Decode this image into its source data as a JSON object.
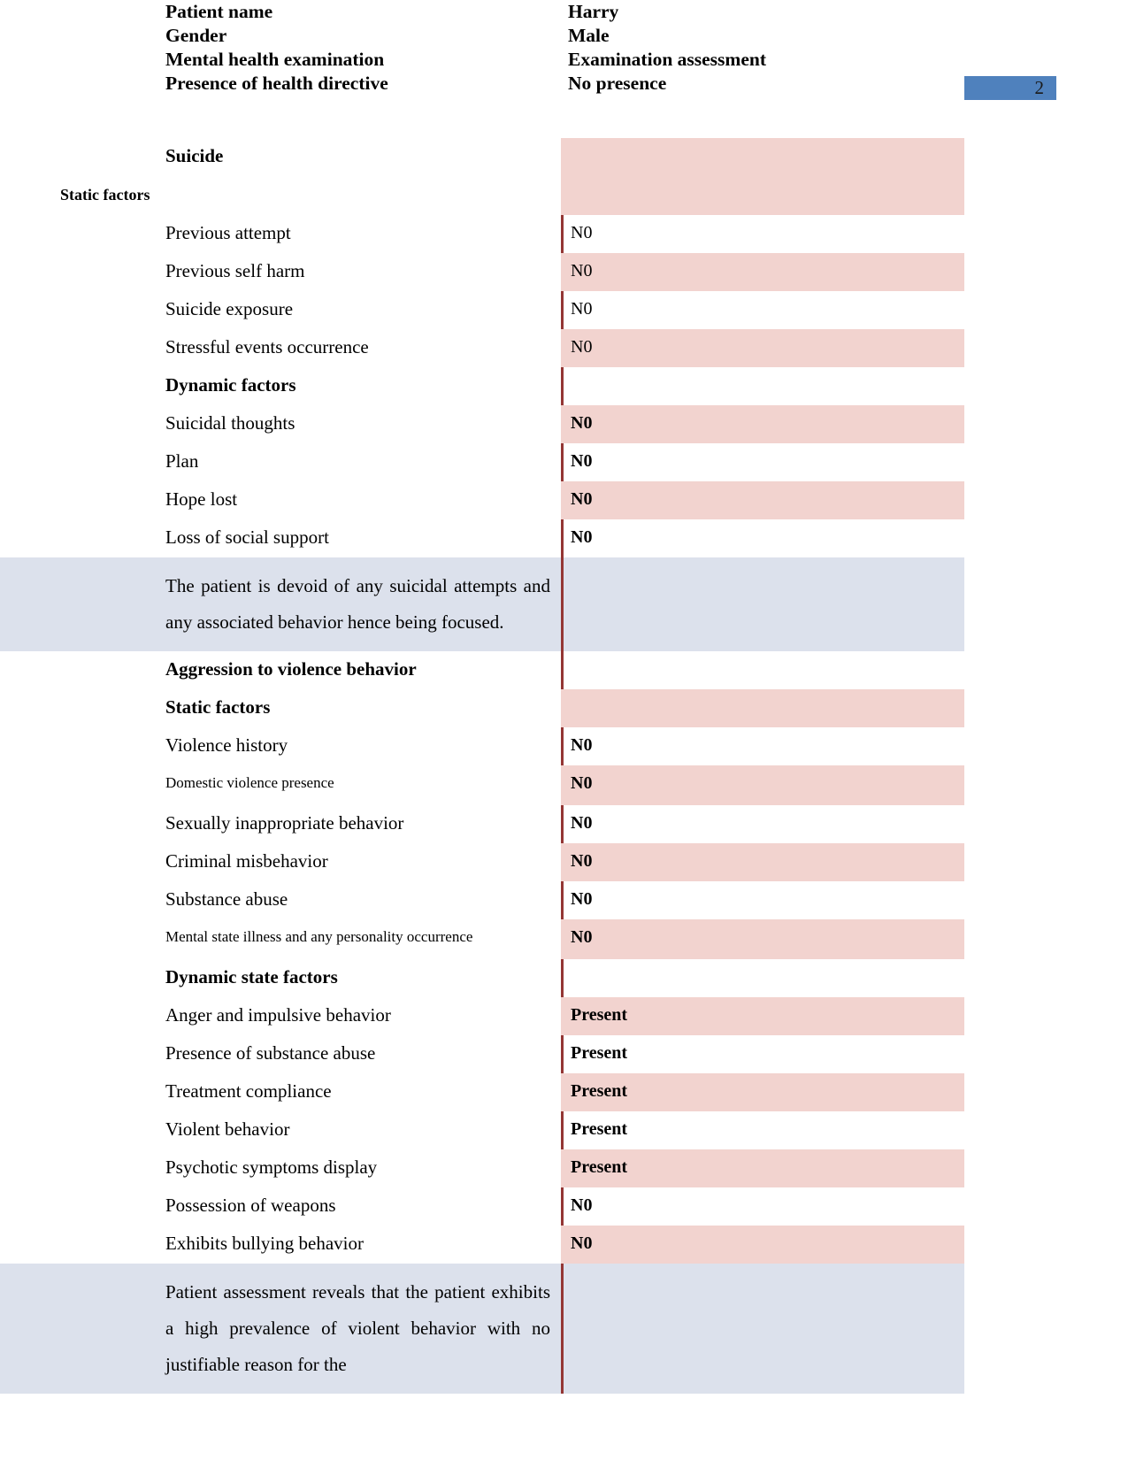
{
  "header": {
    "rows": [
      {
        "label": "Patient name",
        "value": "Harry"
      },
      {
        "label": "Gender",
        "value": "Male"
      },
      {
        "label": "Mental health examination",
        "value": "Examination assessment"
      },
      {
        "label": "Presence of health directive",
        "value": "No presence"
      }
    ]
  },
  "page_badge": {
    "number": "2",
    "color": "#4f81bd"
  },
  "colors": {
    "shade_pink": "#f2d3cf",
    "narrative_blue": "#dce1ec",
    "divider_red": "#943634",
    "badge_blue": "#4f81bd"
  },
  "table": {
    "rows": [
      {
        "label": "Suicide",
        "value": "",
        "style": "section",
        "shade": "shade"
      },
      {
        "label": "Static factors",
        "value": "",
        "style": "subhead-indent",
        "shade": "shade"
      },
      {
        "label": "Previous attempt",
        "value": "N0",
        "style": "normal",
        "shade": "plain"
      },
      {
        "label": "Previous self harm",
        "value": "N0",
        "style": "normal",
        "shade": "shade"
      },
      {
        "label": "Suicide exposure",
        "value": "N0",
        "style": "normal",
        "shade": "plain"
      },
      {
        "label": "Stressful events occurrence",
        "value": "N0",
        "style": "normal",
        "shade": "shade"
      },
      {
        "label": "Dynamic factors",
        "value": "",
        "style": "section",
        "shade": "plain"
      },
      {
        "label": "Suicidal thoughts",
        "value": "N0",
        "style": "normal",
        "value_bold": true,
        "shade": "shade"
      },
      {
        "label": "Plan",
        "value": "N0",
        "style": "normal",
        "value_bold": true,
        "shade": "plain"
      },
      {
        "label": "Hope lost",
        "value": "N0",
        "style": "normal",
        "value_bold": true,
        "shade": "shade"
      },
      {
        "label": "Loss of social support",
        "value": "N0",
        "style": "normal",
        "value_bold": true,
        "shade": "plain"
      },
      {
        "label": "The patient is devoid of any suicidal attempts and any associated behavior hence being focused.",
        "value": "",
        "style": "narrative",
        "shade": "narrative"
      },
      {
        "label": "Aggression to violence behavior",
        "value": "",
        "style": "section",
        "shade": "plain"
      },
      {
        "label": "Static factors",
        "value": "",
        "style": "section",
        "shade": "shade"
      },
      {
        "label": "Violence history",
        "value": "N0",
        "style": "normal",
        "value_bold": true,
        "shade": "plain"
      },
      {
        "label": "Domestic violence presence",
        "value": "N0",
        "style": "small",
        "value_bold": true,
        "shade": "shade"
      },
      {
        "label": "Sexually inappropriate behavior",
        "value": "N0",
        "style": "normal",
        "value_bold": true,
        "shade": "plain"
      },
      {
        "label": "Criminal misbehavior",
        "value": "N0",
        "style": "normal",
        "value_bold": true,
        "shade": "shade"
      },
      {
        "label": "Substance abuse",
        "value": "N0",
        "style": "normal",
        "value_bold": true,
        "shade": "plain"
      },
      {
        "label": "Mental state illness and any personality occurrence",
        "value": "N0",
        "style": "small",
        "value_bold": true,
        "shade": "shade"
      },
      {
        "label": "Dynamic state factors",
        "value": "",
        "style": "section",
        "shade": "plain"
      },
      {
        "label": "Anger and impulsive behavior",
        "value": "Present",
        "style": "normal",
        "value_bold": true,
        "shade": "shade"
      },
      {
        "label": "Presence of substance abuse",
        "value": "Present",
        "style": "normal",
        "value_bold": true,
        "shade": "plain"
      },
      {
        "label": "Treatment compliance",
        "value": "Present",
        "style": "normal",
        "value_bold": true,
        "shade": "shade"
      },
      {
        "label": "Violent behavior",
        "value": "Present",
        "style": "normal",
        "value_bold": true,
        "shade": "plain"
      },
      {
        "label": "Psychotic symptoms display",
        "value": "Present",
        "style": "normal",
        "value_bold": true,
        "shade": "shade"
      },
      {
        "label": "Possession of weapons",
        "value": "N0",
        "style": "normal",
        "value_bold": true,
        "shade": "plain"
      },
      {
        "label": "Exhibits bullying behavior",
        "value": "N0",
        "style": "normal",
        "value_bold": true,
        "shade": "shade"
      },
      {
        "label": "Patient assessment reveals that the patient exhibits a high prevalence of violent behavior with no justifiable reason for the",
        "value": "",
        "style": "narrative",
        "shade": "narrative"
      }
    ]
  }
}
